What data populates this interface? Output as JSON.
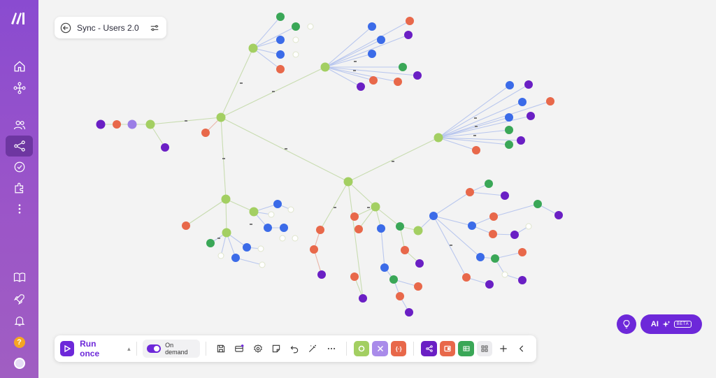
{
  "scenario": {
    "title": "Sync - Users 2.0"
  },
  "toolbar": {
    "run_label": "Run once",
    "schedule_label": "On demand",
    "tile_text_parser": "{·}"
  },
  "ai": {
    "label": "AI",
    "badge": "BETA"
  },
  "sidebar": {
    "items": [
      "home-icon",
      "templates-icon",
      "team-icon",
      "scenarios-icon",
      "connections-icon",
      "apps-icon",
      "more-icon"
    ],
    "bottom_items": [
      "docs-icon",
      "rocket-icon",
      "notifications-icon",
      "help-icon",
      "avatar"
    ],
    "help_label": "?"
  },
  "colors": {
    "accent": "#6d28d9",
    "router_green": "#a3cf62",
    "http_orange": "#e8684a",
    "tools_purple": "#6a1fc4",
    "ms_blue": "#3b6be8",
    "sheets_green": "#3aa757"
  }
}
